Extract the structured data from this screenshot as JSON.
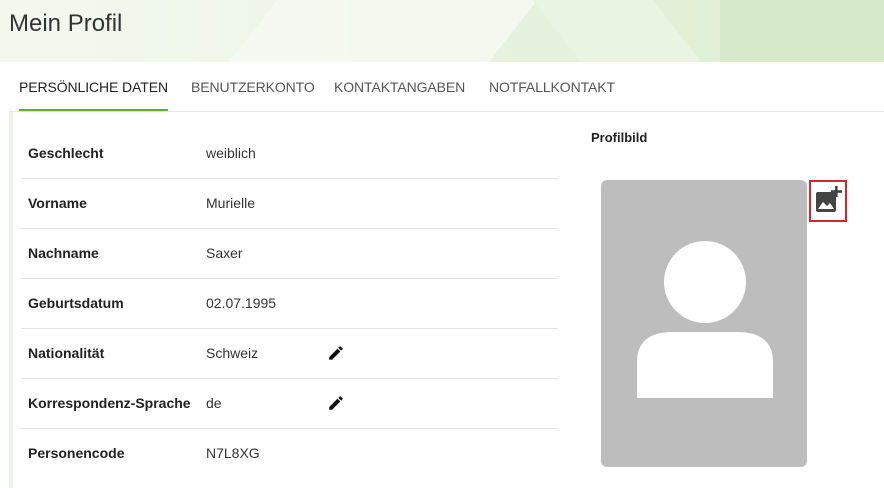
{
  "header": {
    "title": "Mein Profil"
  },
  "tabs": [
    {
      "label": "PERSÖNLICHE DATEN",
      "active": true
    },
    {
      "label": "BENUTZERKONTO",
      "active": false
    },
    {
      "label": "KONTAKTANGABEN",
      "active": false
    },
    {
      "label": "NOTFALLKONTAKT",
      "active": false
    }
  ],
  "fields": [
    {
      "label": "Geschlecht",
      "value": "weiblich",
      "editable": false
    },
    {
      "label": "Vorname",
      "value": "Murielle",
      "editable": false
    },
    {
      "label": "Nachname",
      "value": "Saxer",
      "editable": false
    },
    {
      "label": "Geburtsdatum",
      "value": "02.07.1995",
      "editable": false
    },
    {
      "label": "Nationalität",
      "value": "Schweiz",
      "editable": true
    },
    {
      "label": "Korrespondenz-Sprache",
      "value": "de",
      "editable": true
    },
    {
      "label": "Personencode",
      "value": "N7L8XG",
      "editable": false
    }
  ],
  "profile_photo": {
    "title": "Profilbild"
  },
  "icons": {
    "edit": "pencil-icon",
    "add_photo": "add-photo-icon",
    "placeholder": "person-placeholder-icon"
  },
  "colors": {
    "accent": "#59b530",
    "highlight": "#e0202a",
    "placeholder_bg": "#bdbdbd"
  }
}
